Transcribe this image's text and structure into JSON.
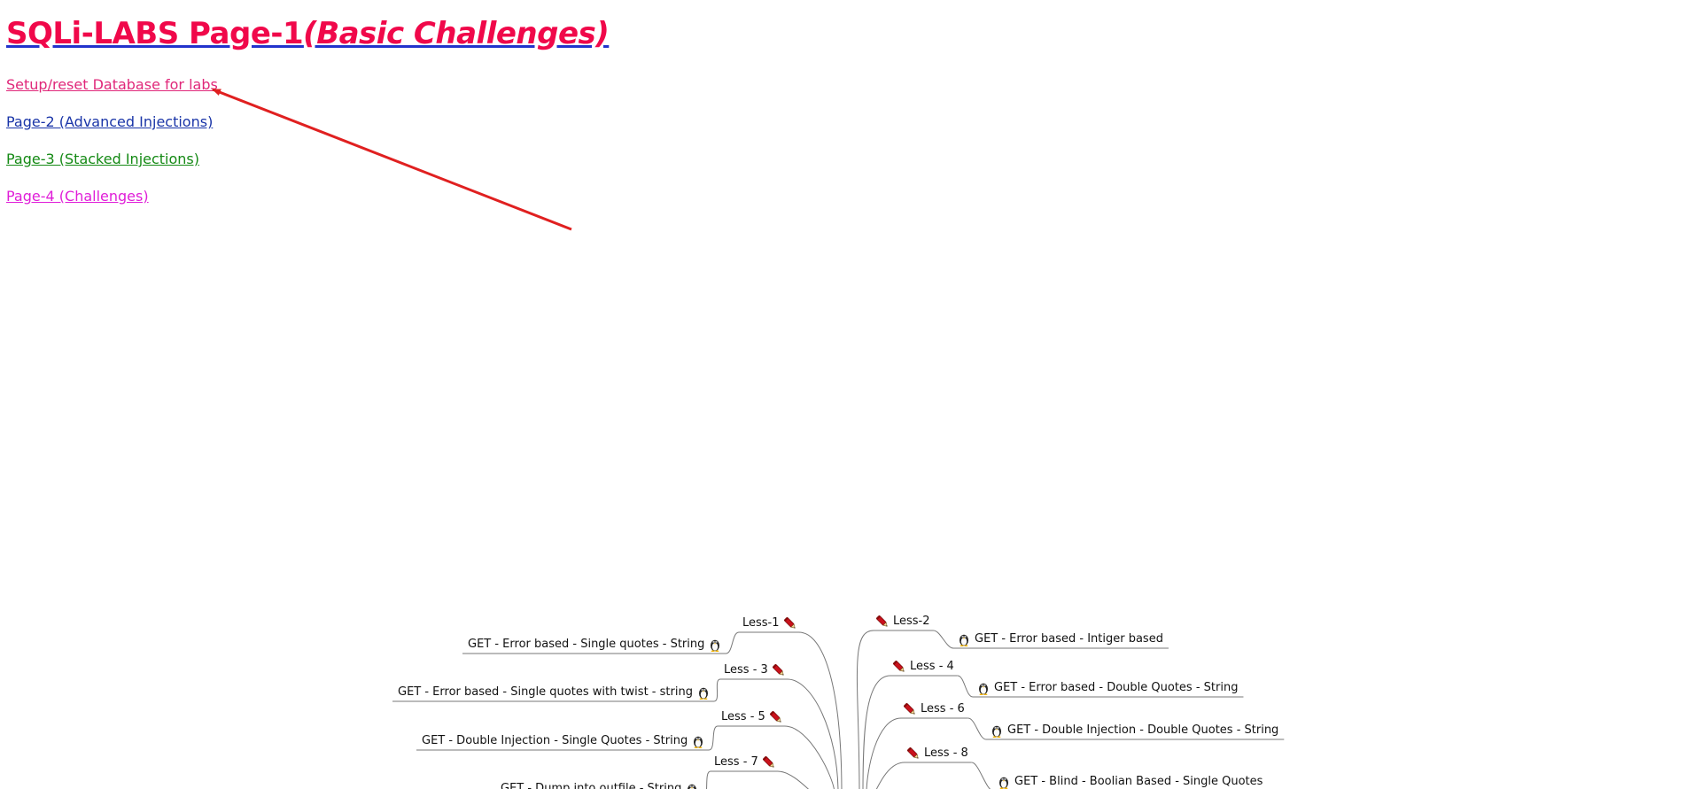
{
  "header": {
    "title_main": "SQLi-LABS Page-1",
    "title_sub": "(Basic Challenges)"
  },
  "nav": {
    "setup": "Setup/reset Database for labs",
    "page2": "Page-2 (Advanced Injections)",
    "page3": "Page-3 (Stacked Injections)",
    "page4": "Page-4 (Challenges)"
  },
  "colors": {
    "title": "#f0084a",
    "setup": "#e0287a",
    "page2": "#1a35a8",
    "page3": "#158a15",
    "page4": "#e01ed8",
    "arrow": "#e02020"
  },
  "mindmap": {
    "left": [
      {
        "less": "Less-1",
        "desc": "GET - Error based - Single quotes - String"
      },
      {
        "less": "Less - 3",
        "desc": "GET - Error based - Single quotes with twist - string"
      },
      {
        "less": "Less - 5",
        "desc": "GET - Double Injection - Single Quotes - String"
      },
      {
        "less": "Less - 7",
        "desc": "GET - Dump into outfile - String"
      }
    ],
    "right": [
      {
        "less": "Less-2",
        "desc": "GET - Error based - Intiger based"
      },
      {
        "less": "Less - 4",
        "desc": "GET - Error based - Double Quotes - String"
      },
      {
        "less": "Less - 6",
        "desc": "GET - Double Injection - Double Quotes - String"
      },
      {
        "less": "Less - 8",
        "desc": "GET - Blind - Boolian Based - Single Quotes"
      }
    ],
    "icons": {
      "less_icon": "pen-icon",
      "desc_icon": "tux-penguin-icon"
    }
  }
}
